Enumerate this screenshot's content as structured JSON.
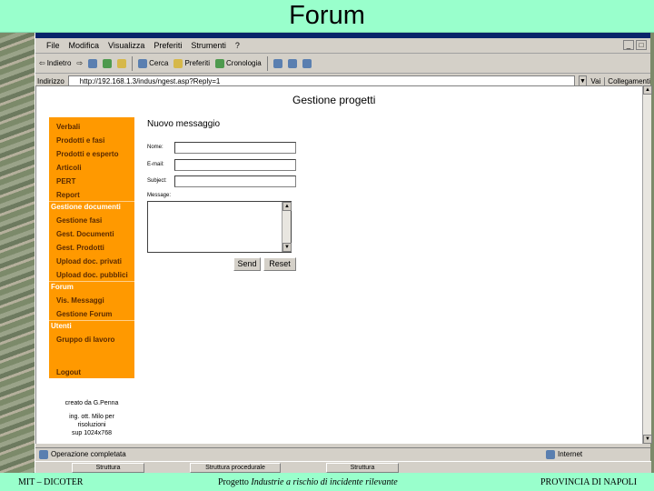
{
  "slide": {
    "title": "Forum",
    "footer_left": "MIT – DICOTER",
    "footer_center_prefix": "Progetto ",
    "footer_center_italic": "Industrie a rischio di incidente rilevante",
    "footer_right": "PROVINCIA DI NAPOLI"
  },
  "browser": {
    "menu": [
      "File",
      "Modifica",
      "Visualizza",
      "Preferiti",
      "Strumenti",
      "?"
    ],
    "toolbar": {
      "back": "Indietro",
      "search": "Cerca",
      "favorites": "Preferiti",
      "history": "Cronologia"
    },
    "address_label": "Indirizzo",
    "address_value": "http://192.168.1.3/indus/ngest.asp?Reply=1",
    "go_label": "Vai",
    "links_label": "Collegamenti",
    "status_left": "Operazione completata",
    "status_right": "Internet",
    "taskbar": [
      "Struttura",
      "Struttura procedurale",
      "Struttura"
    ]
  },
  "page": {
    "heading": "Gestione progetti",
    "sidebar": {
      "items_top": [
        "Verbali",
        "Prodotti e fasi",
        "Prodotti e esperto",
        "Articoli",
        "PERT",
        "Report"
      ],
      "section_documenti": "Gestione documenti",
      "items_documenti": [
        "Gestione fasi",
        "Gest. Documenti",
        "Gest. Prodotti",
        "Upload doc. privati",
        "Upload doc. pubblici"
      ],
      "section_forum": "Forum",
      "items_forum": [
        "Vis. Messaggi",
        "Gestione Forum"
      ],
      "section_utenti": "Utenti",
      "items_utenti": [
        "Gruppo di lavoro"
      ],
      "logout": "Logout",
      "credits_line1": "creato da G.Penna",
      "credits_line2": "ing. ott. Milo per",
      "credits_line3": "risoluzioni",
      "credits_line4": "sup 1024x768"
    },
    "form": {
      "title": "Nuovo messaggio",
      "name_label": "Nome:",
      "email_label": "E-mail:",
      "subject_label": "Subject:",
      "message_label": "Message:",
      "name_value": "",
      "email_value": "",
      "subject_value": "",
      "message_value": "",
      "send_label": "Send",
      "reset_label": "Reset"
    }
  },
  "colors": {
    "slide_bar": "#99ffcc",
    "sidebar": "#ff9900"
  }
}
